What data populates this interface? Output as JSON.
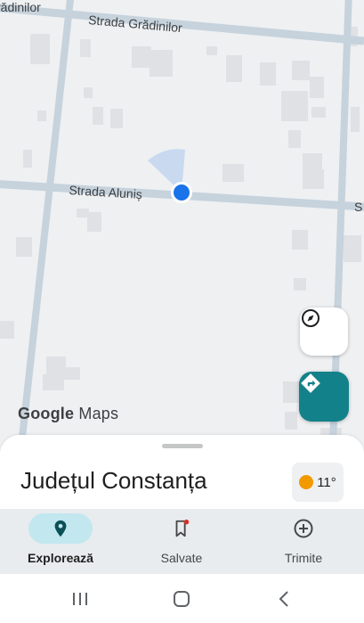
{
  "map": {
    "streets": {
      "top": "Strada Grădinilor",
      "top_left_fragment": "rădinilor",
      "middle": "Strada Aluniș",
      "right_fragment": "S"
    },
    "attribution": {
      "google": "Google",
      "maps": "Maps"
    },
    "colors": {
      "road": "#c6d2dc",
      "building": "#dfe1e5",
      "location_dot": "#1a73e8",
      "directions_button": "#13818a"
    }
  },
  "buttons": {
    "compass_icon": "compass-icon",
    "directions_icon": "directions-icon"
  },
  "sheet": {
    "place_title": "Județul Constanța",
    "weather": {
      "temperature": "11°",
      "icon": "sun-icon"
    }
  },
  "bottom_nav": {
    "items": [
      {
        "label": "Explorează",
        "icon": "location-pin-icon",
        "active": true
      },
      {
        "label": "Salvate",
        "icon": "bookmark-icon",
        "active": false,
        "badge": true
      },
      {
        "label": "Trimite",
        "icon": "add-circle-icon",
        "active": false
      }
    ]
  },
  "system_nav": {
    "buttons": [
      "recents-icon",
      "home-icon",
      "back-icon"
    ]
  }
}
